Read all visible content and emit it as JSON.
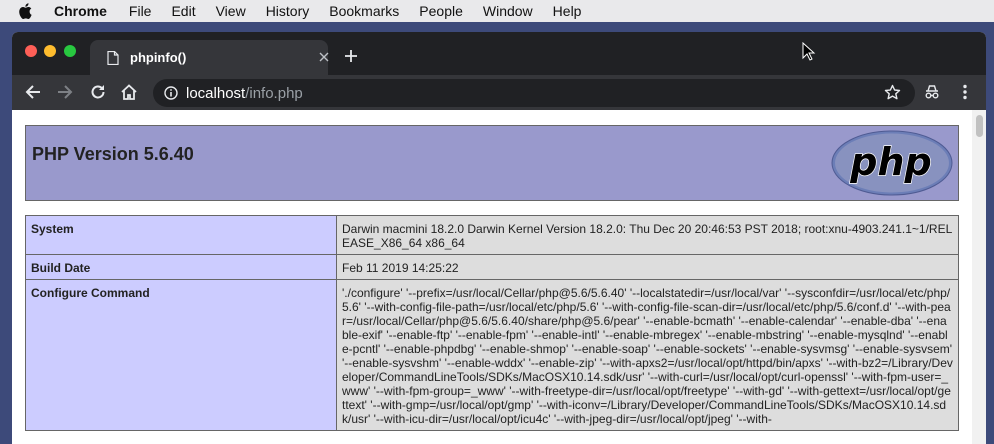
{
  "menubar": {
    "apple_icon": "apple-icon",
    "app_name": "Chrome",
    "items": [
      "File",
      "Edit",
      "View",
      "History",
      "Bookmarks",
      "People",
      "Window",
      "Help"
    ]
  },
  "tab": {
    "title": "phpinfo()",
    "icon": "document-icon"
  },
  "address_bar": {
    "host": "localhost",
    "path": "/info.php"
  },
  "page": {
    "php_version": "PHP Version 5.6.40",
    "logo_text": "php",
    "rows": [
      {
        "key": "System",
        "value": "Darwin macmini 18.2.0 Darwin Kernel Version 18.2.0: Thu Dec 20 20:46:53 PST 2018; root:xnu-4903.241.1~1/RELEASE_X86_64 x86_64"
      },
      {
        "key": "Build Date",
        "value": "Feb 11 2019 14:25:22"
      },
      {
        "key": "Configure Command",
        "value": "'./configure' '--prefix=/usr/local/Cellar/php@5.6/5.6.40' '--localstatedir=/usr/local/var' '--sysconfdir=/usr/local/etc/php/5.6' '--with-config-file-path=/usr/local/etc/php/5.6' '--with-config-file-scan-dir=/usr/local/etc/php/5.6/conf.d' '--with-pear=/usr/local/Cellar/php@5.6/5.6.40/share/php@5.6/pear' '--enable-bcmath' '--enable-calendar' '--enable-dba' '--enable-exif' '--enable-ftp' '--enable-fpm' '--enable-intl' '--enable-mbregex' '--enable-mbstring' '--enable-mysqlnd' '--enable-pcntl' '--enable-phpdbg' '--enable-shmop' '--enable-soap' '--enable-sockets' '--enable-sysvmsg' '--enable-sysvsem' '--enable-sysvshm' '--enable-wddx' '--enable-zip' '--with-apxs2=/usr/local/opt/httpd/bin/apxs' '--with-bz2=/Library/Developer/CommandLineTools/SDKs/MacOSX10.14.sdk/usr' '--with-curl=/usr/local/opt/curl-openssl' '--with-fpm-user=_www' '--with-fpm-group=_www' '--with-freetype-dir=/usr/local/opt/freetype' '--with-gd' '--with-gettext=/usr/local/opt/gettext' '--with-gmp=/usr/local/opt/gmp' '--with-iconv=/Library/Developer/CommandLineTools/SDKs/MacOSX10.14.sdk/usr' '--with-icu-dir=/usr/local/opt/icu4c' '--with-jpeg-dir=/usr/local/opt/jpeg' '--with-"
      }
    ]
  },
  "colors": {
    "header_bg": "#9999cc",
    "key_bg": "#ccccff",
    "value_bg": "#dddddd",
    "browser_dark": "#202124",
    "browser_toolbar": "#35363a"
  }
}
